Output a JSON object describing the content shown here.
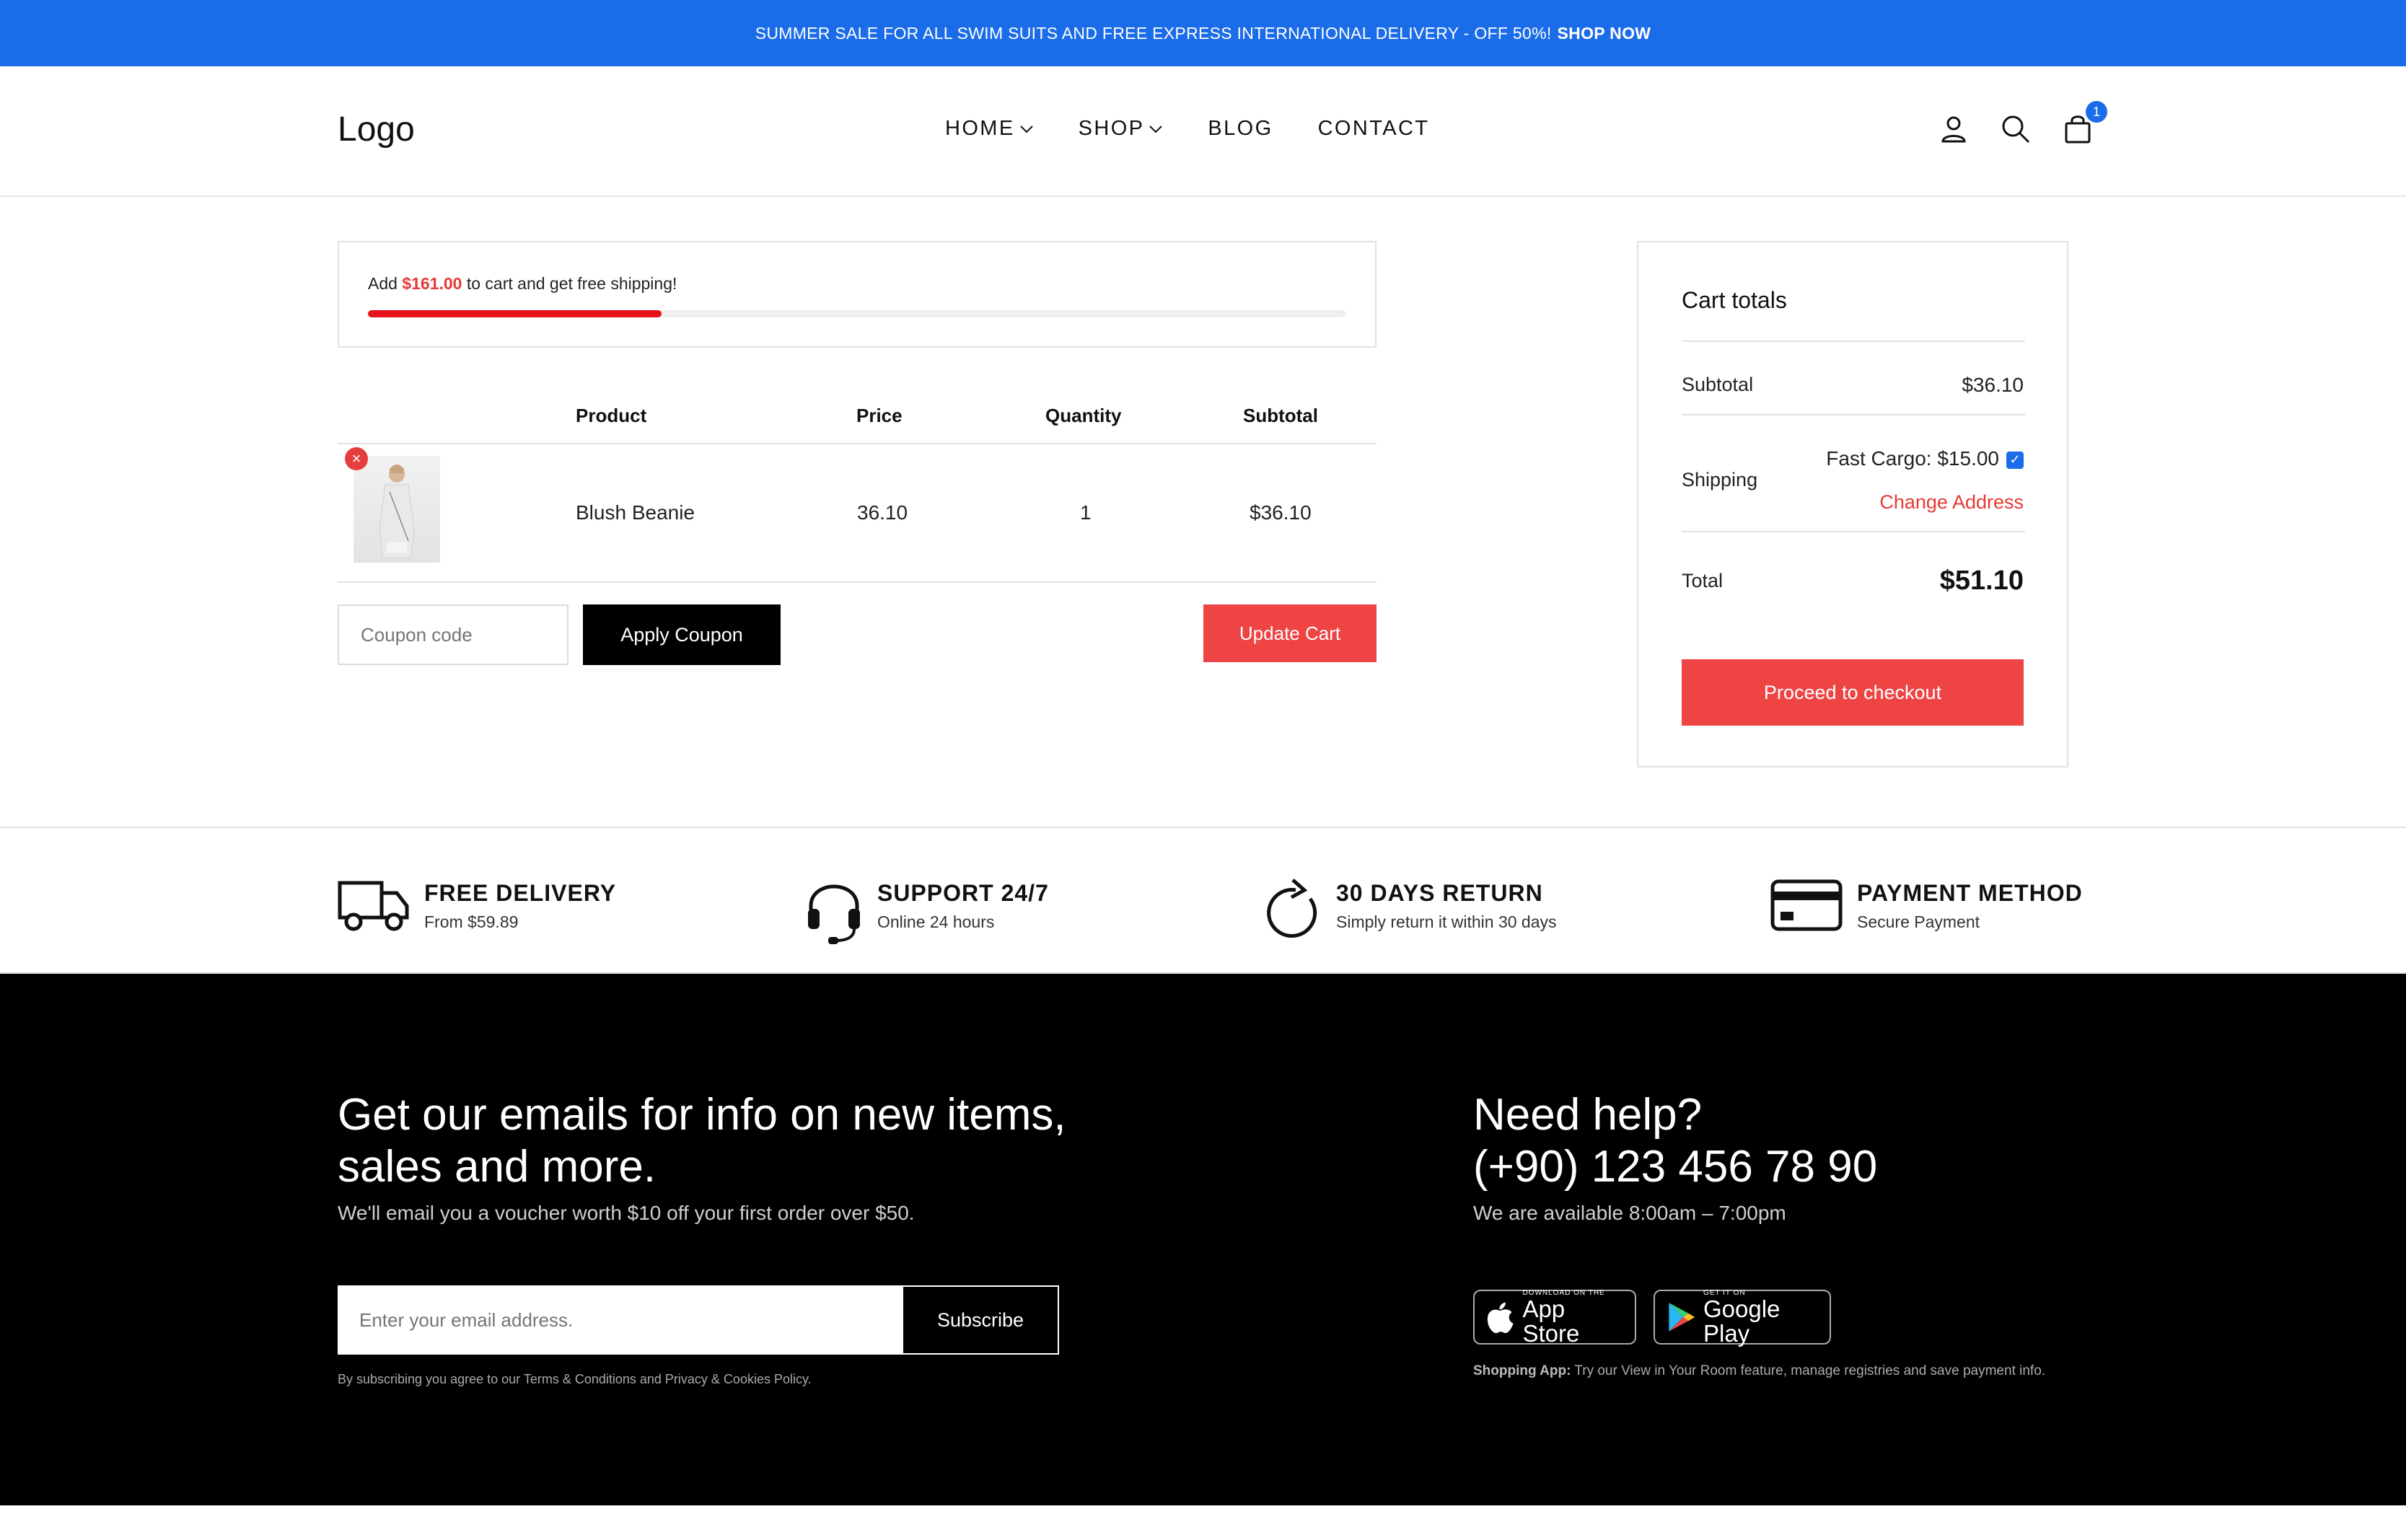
{
  "announcement": {
    "text": "SUMMER SALE FOR ALL SWIM SUITS AND FREE EXPRESS INTERNATIONAL DELIVERY - OFF 50%!",
    "cta": "SHOP NOW"
  },
  "header": {
    "logo": "Logo",
    "nav": [
      "HOME",
      "SHOP",
      "BLOG",
      "CONTACT"
    ],
    "cart_count": "1"
  },
  "shipping_bar": {
    "prefix": "Add",
    "amount": "$161.00",
    "suffix": "to cart and get free shipping!",
    "progress": 0.3
  },
  "cart": {
    "columns": [
      "Product",
      "Price",
      "Quantity",
      "Subtotal"
    ],
    "items": [
      {
        "name": "Blush Beanie",
        "price": "36.10",
        "quantity": "1",
        "subtotal": "$36.10"
      }
    ],
    "coupon_placeholder": "Coupon code",
    "apply_coupon": "Apply Coupon",
    "update_cart": "Update Cart"
  },
  "totals": {
    "title": "Cart totals",
    "subtotal_label": "Subtotal",
    "subtotal_value": "$36.10",
    "shipping_label": "Shipping",
    "shipping_option": "Fast Cargo: $15.00",
    "change_address": "Change Address",
    "total_label": "Total",
    "total_value": "$51.10",
    "checkout": "Proceed to checkout"
  },
  "features": [
    {
      "title": "FREE DELIVERY",
      "sub": "From $59.89",
      "icon": "truck-icon"
    },
    {
      "title": "SUPPORT 24/7",
      "sub": "Online 24 hours",
      "icon": "headset-icon"
    },
    {
      "title": "30 DAYS RETURN",
      "sub": "Simply return it within 30 days",
      "icon": "return-icon"
    },
    {
      "title": "PAYMENT METHOD",
      "sub": "Secure Payment",
      "icon": "credit-card-icon"
    }
  ],
  "footer": {
    "newsletter_line1": "Get our emails for info on new items,",
    "newsletter_line2": "sales and more.",
    "newsletter_sub": "We'll email you a voucher worth $10 off your first order over $50.",
    "email_placeholder": "Enter your email address.",
    "subscribe": "Subscribe",
    "terms": "By subscribing you agree to our Terms & Conditions and Privacy & Cookies Policy.",
    "help_line1": "Need help?",
    "help_line2": "(+90) 123 456 78 90",
    "hours": "We are available 8:00am – 7:00pm",
    "app_store_small": "DOWNLOAD ON THE",
    "app_store_big": "App Store",
    "google_small": "GET IT ON",
    "google_big": "Google Play",
    "app_note_bold": "Shopping App:",
    "app_note": "Try our View in Your Room feature, manage registries and save payment info."
  },
  "colors": {
    "accent": "#1b6ce8",
    "sale_red": "#ee4444",
    "progress_red": "#e8101c"
  }
}
